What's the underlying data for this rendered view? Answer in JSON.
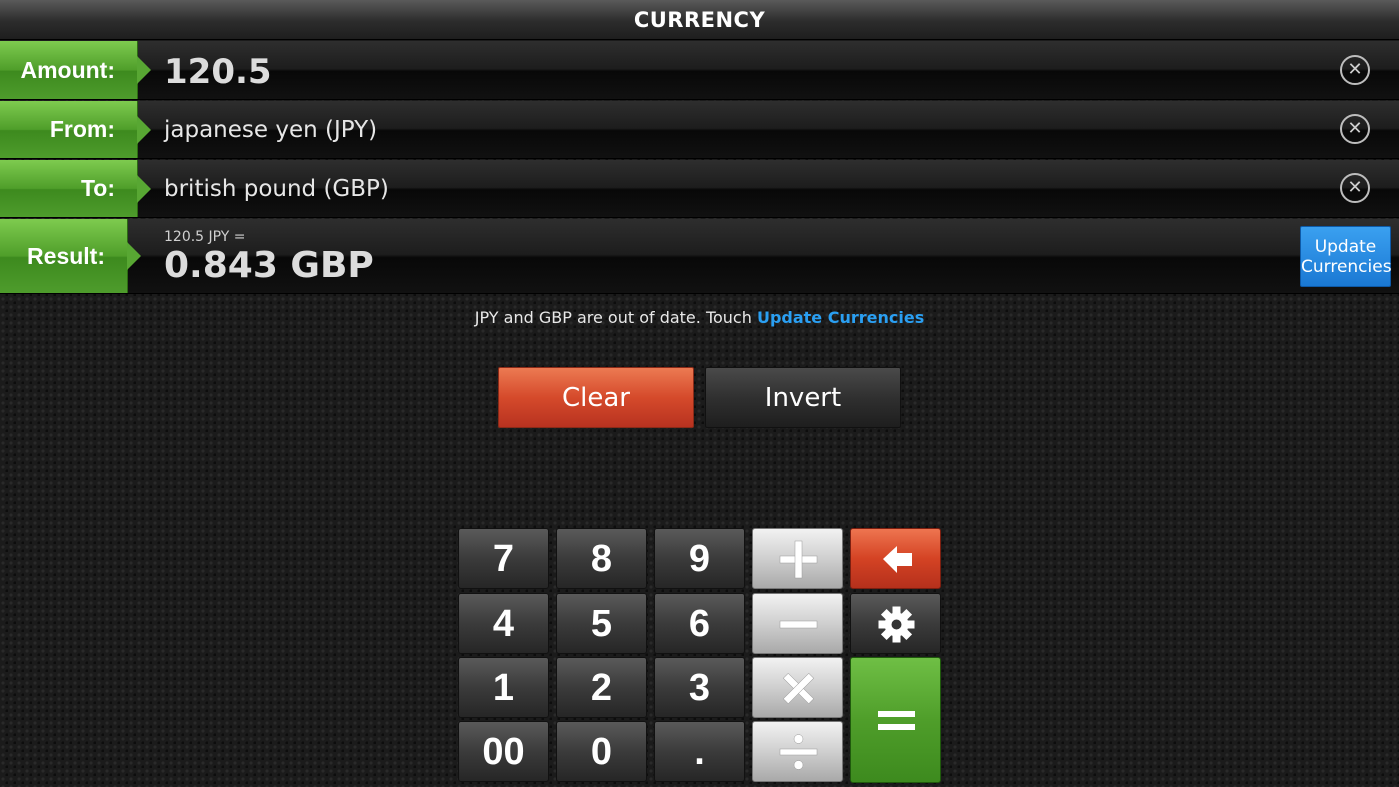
{
  "app": {
    "title": "CURRENCY"
  },
  "fields": {
    "amount": {
      "label": "Amount:",
      "value": "120.5"
    },
    "from": {
      "label": "From:",
      "value": "japanese yen (JPY)"
    },
    "to": {
      "label": "To:",
      "value": "british pound (GBP)"
    },
    "result": {
      "label": "Result:",
      "expression": "120.5 JPY =",
      "value": "0.843 GBP"
    }
  },
  "update_button": {
    "label_line1": "Update",
    "label_line2": "Currencies"
  },
  "notice": {
    "text": "JPY and GBP are out of date. Touch ",
    "link": "Update Currencies"
  },
  "actions": {
    "clear": "Clear",
    "invert": "Invert"
  },
  "keypad": {
    "k7": "7",
    "k8": "8",
    "k9": "9",
    "k4": "4",
    "k5": "5",
    "k6": "6",
    "k1": "1",
    "k2": "2",
    "k3": "3",
    "k00": "00",
    "k0": "0",
    "kdot": "."
  },
  "icons": {
    "clear_field": "close-circle-icon",
    "plus": "plus-icon",
    "minus": "minus-icon",
    "multiply": "multiply-icon",
    "divide": "divide-icon",
    "backspace": "arrow-left-icon",
    "settings": "gear-icon",
    "equals": "equals-icon"
  },
  "colors": {
    "label_green": "#4f9e2a",
    "update_blue": "#1a78d3",
    "link_blue": "#2a9ff2",
    "clear_red": "#d54a2b"
  }
}
